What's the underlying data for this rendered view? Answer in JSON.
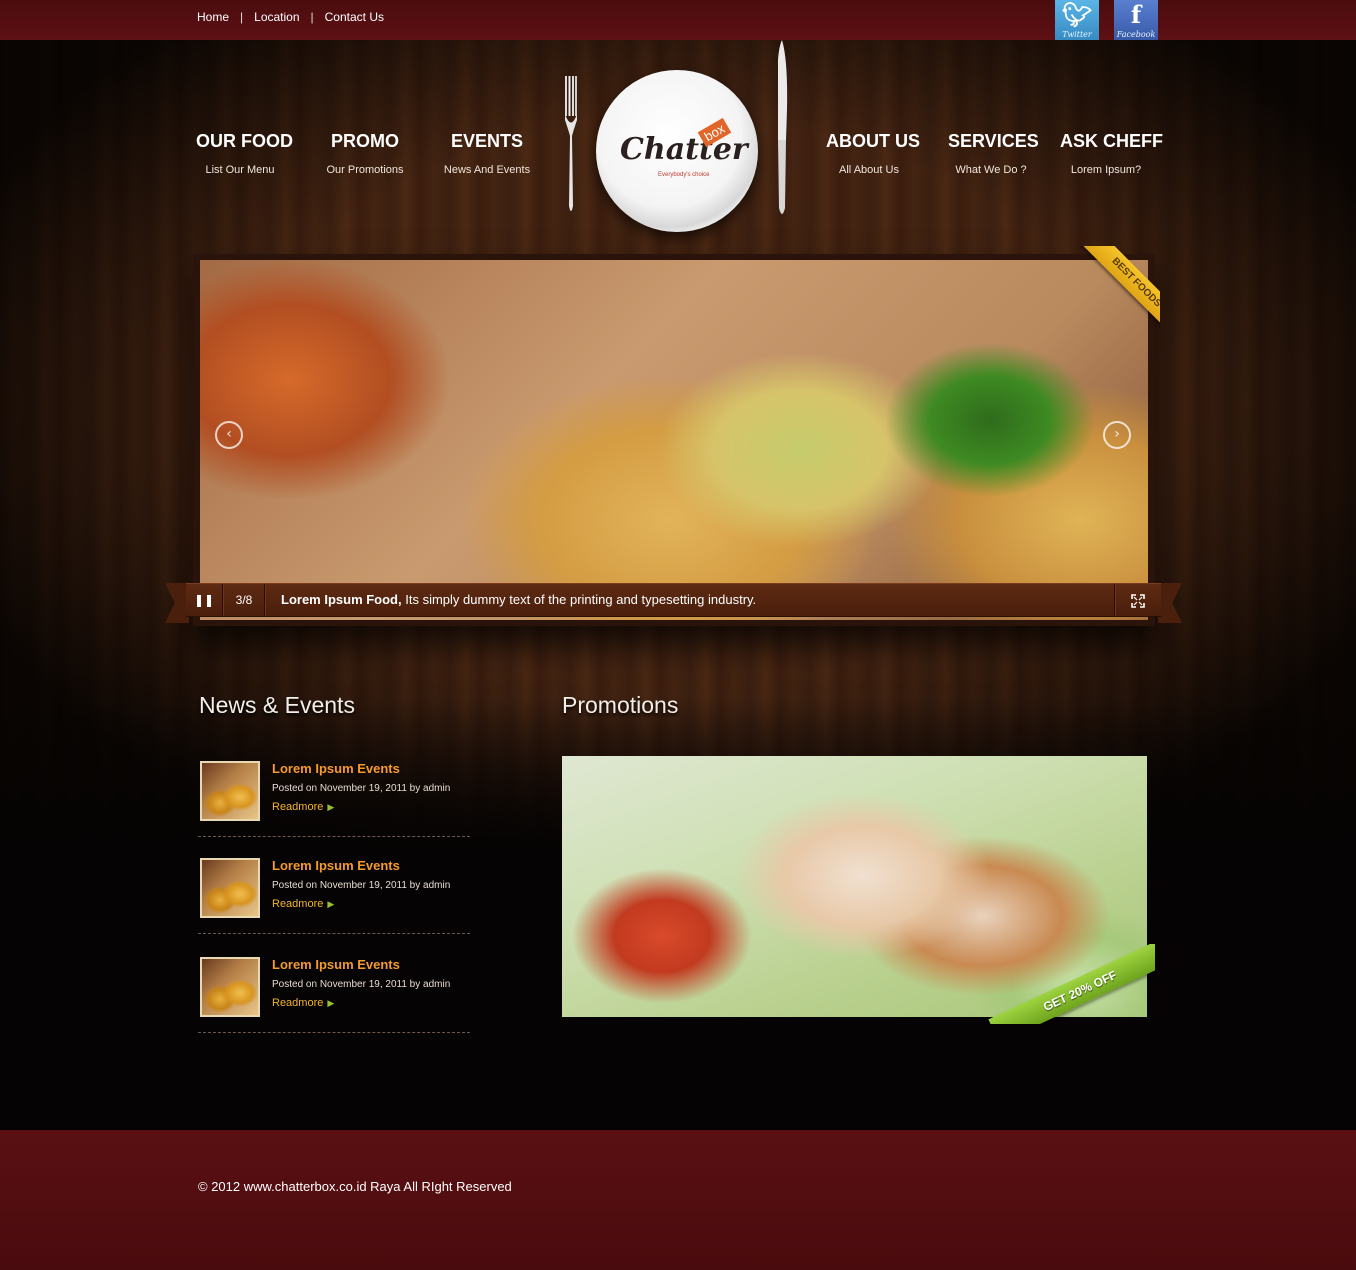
{
  "top_nav": {
    "links": [
      "Home",
      "Location",
      "Contact Us"
    ],
    "separator": "|"
  },
  "social": {
    "twitter_label": "Twitter",
    "facebook_label": "Facebook"
  },
  "logo": {
    "name": "Chatter",
    "box": "box",
    "tagline": "Everybody's choice"
  },
  "main_nav": [
    {
      "title": "OUR FOOD",
      "subtitle": "List Our Menu"
    },
    {
      "title": "PROMO",
      "subtitle": "Our Promotions"
    },
    {
      "title": "EVENTS",
      "subtitle": "News And Events"
    },
    {
      "title": "ABOUT US",
      "subtitle": "All About Us"
    },
    {
      "title": "SERVICES",
      "subtitle": "What We Do ?"
    },
    {
      "title": "ASK CHEFF",
      "subtitle": "Lorem Ipsum?"
    }
  ],
  "slider": {
    "badge": "BEST FOODS",
    "counter": "3/8",
    "caption_title": "Lorem Ipsum Food,",
    "caption_text": "Its simply dummy text of the printing and typesetting industry."
  },
  "news": {
    "heading": "News & Events",
    "items": [
      {
        "title": "Lorem Ipsum Events",
        "meta": "Posted on November 19, 2011 by admin",
        "more": "Readmore"
      },
      {
        "title": "Lorem Ipsum Events",
        "meta": "Posted on November 19, 2011 by admin",
        "more": "Readmore"
      },
      {
        "title": "Lorem Ipsum Events",
        "meta": "Posted on November 19, 2011 by admin",
        "more": "Readmore"
      }
    ]
  },
  "promotions": {
    "heading": "Promotions",
    "badge": "GET 20% OFF"
  },
  "footer": {
    "copyright": "© 2012  www.chatterbox.co.id Raya All RIght Reserved"
  },
  "colors": {
    "topbar": "#5e1014",
    "accent_orange": "#f59a2c",
    "readmore": "#f3b42a",
    "ribbon_gold": "#f5c52b",
    "ribbon_green": "#8bc634"
  }
}
